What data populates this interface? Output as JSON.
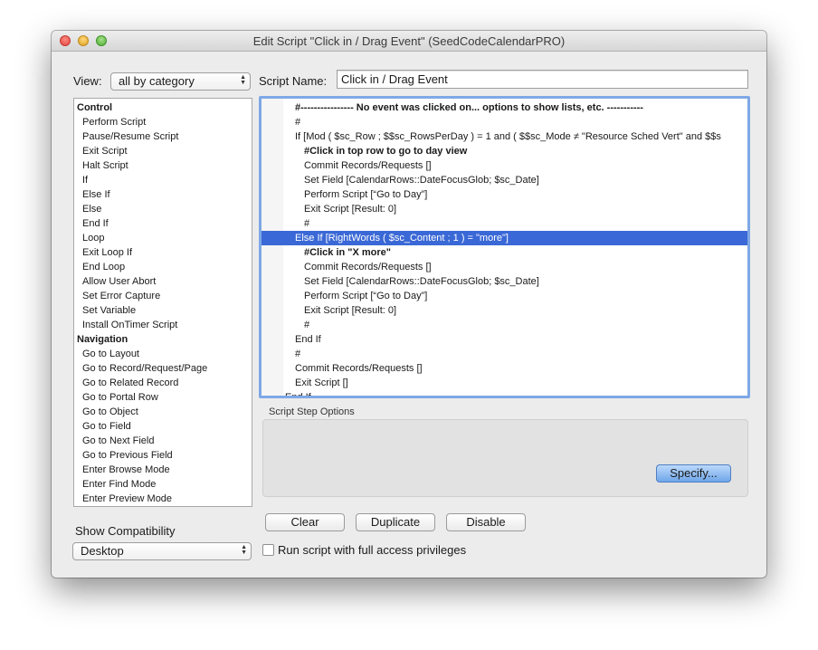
{
  "window": {
    "title": "Edit Script \"Click in / Drag Event\" (SeedCodeCalendarPRO)"
  },
  "view": {
    "label": "View:",
    "selected": "all by category"
  },
  "script_name": {
    "label": "Script Name:",
    "value": "Click in / Drag Event"
  },
  "steps": [
    {
      "text": "Control",
      "category": true
    },
    {
      "text": "Perform Script"
    },
    {
      "text": "Pause/Resume Script"
    },
    {
      "text": "Exit Script"
    },
    {
      "text": "Halt Script"
    },
    {
      "text": "If"
    },
    {
      "text": "Else If"
    },
    {
      "text": "Else"
    },
    {
      "text": "End If"
    },
    {
      "text": "Loop"
    },
    {
      "text": "Exit Loop If"
    },
    {
      "text": "End Loop"
    },
    {
      "text": "Allow User Abort"
    },
    {
      "text": "Set Error Capture"
    },
    {
      "text": "Set Variable"
    },
    {
      "text": "Install OnTimer Script"
    },
    {
      "text": "Navigation",
      "category": true
    },
    {
      "text": "Go to Layout"
    },
    {
      "text": "Go to Record/Request/Page"
    },
    {
      "text": "Go to Related Record"
    },
    {
      "text": "Go to Portal Row"
    },
    {
      "text": "Go to Object"
    },
    {
      "text": "Go to Field"
    },
    {
      "text": "Go to Next Field"
    },
    {
      "text": "Go to Previous Field"
    },
    {
      "text": "Enter Browse Mode"
    },
    {
      "text": "Enter Find Mode"
    },
    {
      "text": "Enter Preview Mode"
    }
  ],
  "script_lines": [
    {
      "text": "#----------------   No event was clicked on... options to show lists, etc.  -----------",
      "indent": 1,
      "comment": true
    },
    {
      "text": "#",
      "indent": 1
    },
    {
      "text": "If [Mod ( $sc_Row ; $$sc_RowsPerDay ) = 1 and ( $$sc_Mode ≠ \"Resource Sched Vert\" and $$s",
      "indent": 1
    },
    {
      "text": "#Click in top row to go to day view",
      "indent": 2,
      "comment": true
    },
    {
      "text": "Commit Records/Requests []",
      "indent": 2
    },
    {
      "text": "Set Field [CalendarRows::DateFocusGlob; $sc_Date]",
      "indent": 2
    },
    {
      "text": "Perform Script [“Go to Day”]",
      "indent": 2
    },
    {
      "text": "Exit Script [Result: 0]",
      "indent": 2
    },
    {
      "text": "#",
      "indent": 2
    },
    {
      "text": "Else If [RightWords ( $sc_Content ; 1 ) = \"more\"]",
      "indent": 1,
      "selected": true
    },
    {
      "text": "#Click in \"X more\"",
      "indent": 2,
      "comment": true
    },
    {
      "text": "Commit Records/Requests []",
      "indent": 2
    },
    {
      "text": "Set Field [CalendarRows::DateFocusGlob; $sc_Date]",
      "indent": 2
    },
    {
      "text": "Perform Script [“Go to Day”]",
      "indent": 2
    },
    {
      "text": "Exit Script [Result: 0]",
      "indent": 2
    },
    {
      "text": "#",
      "indent": 2
    },
    {
      "text": "End If",
      "indent": 1
    },
    {
      "text": "#",
      "indent": 1
    },
    {
      "text": "Commit Records/Requests []",
      "indent": 1
    },
    {
      "text": "Exit Script []",
      "indent": 1
    },
    {
      "text": "End If",
      "indent": 0
    }
  ],
  "options": {
    "title": "Script Step Options",
    "specify_label": "Specify..."
  },
  "buttons": {
    "clear": "Clear",
    "duplicate": "Duplicate",
    "disable": "Disable"
  },
  "compatibility": {
    "label": "Show Compatibility",
    "selected": "Desktop"
  },
  "full_access": {
    "label": "Run script with full access privileges",
    "checked": false
  },
  "colors": {
    "selection": "#3a68d6",
    "focus_ring": "#7ea8e6",
    "default_button": "#6fa6ea"
  }
}
